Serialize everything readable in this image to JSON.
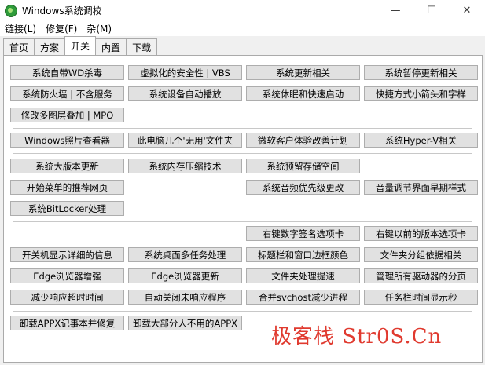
{
  "window": {
    "title": "Windows系统调校",
    "minimize": "—",
    "maximize": "☐",
    "close": "✕"
  },
  "menu": [
    "链接(L)",
    "修复(F)",
    "杂(M)"
  ],
  "tabs": [
    "首页",
    "方案",
    "开关",
    "内置",
    "下载"
  ],
  "active_tab": "开关",
  "buttons": {
    "r1": [
      "系统自带WD杀毒",
      "虚拟化的安全性 | VBS",
      "系统更新相关",
      "系统暂停更新相关"
    ],
    "r2": [
      "系统防火墙 | 不含服务",
      "系统设备自动播放",
      "系统休眠和快速启动",
      "快捷方式小箭头和字样"
    ],
    "r3": [
      "修改多图层叠加 | MPO"
    ],
    "r4": [
      "Windows照片查看器",
      "此电脑几个'无用'文件夹",
      "微软客户体验改善计划",
      "系统Hyper-V相关"
    ],
    "r5": [
      "系统大版本更新",
      "系统内存压缩技术",
      "系统预留存储空间"
    ],
    "r6": [
      "开始菜单的推荐网页",
      "系统音频优先级更改",
      "音量调节界面早期样式"
    ],
    "r7": [
      "系统BitLocker处理"
    ],
    "r8": [
      "右键数字签名选项卡",
      "右键以前的版本选项卡"
    ],
    "r9": [
      "开关机显示详细的信息",
      "系统桌面多任务处理",
      "标题栏和窗口边框颜色",
      "文件夹分组依据相关"
    ],
    "r10": [
      "Edge浏览器增强",
      "Edge浏览器更新",
      "文件夹处理提速",
      "管理所有驱动器的分页"
    ],
    "r11": [
      "减少响应超时时间",
      "自动关闭未响应程序",
      "合并svchost减少进程",
      "任务栏时间显示秒"
    ],
    "r12": [
      "卸载APPX记事本并修复",
      "卸载大部分人不用的APPX"
    ]
  },
  "watermark": "极客栈 Str0S.Cn"
}
